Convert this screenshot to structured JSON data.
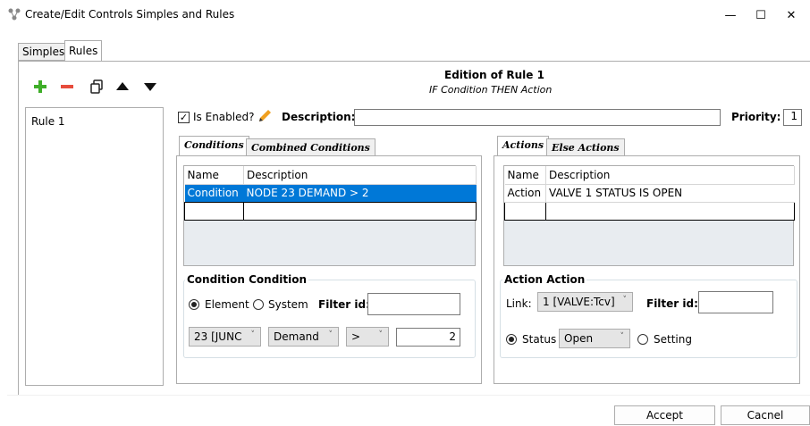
{
  "window": {
    "title": "Create/Edit Controls Simples and Rules",
    "minimize": "—",
    "maximize": "☐",
    "close": "✕"
  },
  "tabs": {
    "simples": "Simples",
    "rules": "Rules"
  },
  "rule_list": [
    "Rule 1"
  ],
  "header": {
    "title": "Edition of Rule 1",
    "subtitle": "IF Condition THEN Action"
  },
  "enabled": {
    "label": "Is Enabled?",
    "checked": "✓"
  },
  "description": {
    "label": "Description:",
    "value": ""
  },
  "priority": {
    "label": "Priority:",
    "value": "1"
  },
  "conditions": {
    "tab_active": "Conditions",
    "tab_inactive": "Combined Conditions",
    "columns": [
      "Name",
      "Description"
    ],
    "rows": [
      {
        "name": "Condition",
        "description": "NODE 23 DEMAND > 2"
      }
    ],
    "group_title": "Condition Condition",
    "element_label": "Element",
    "system_label": "System",
    "filter_label": "Filter id:",
    "filter_value": "",
    "node_combo": "23 [JUNC",
    "attr_combo": "Demand",
    "op_combo": ">",
    "value": "2"
  },
  "actions": {
    "tab_active": "Actions",
    "tab_inactive": "Else Actions",
    "columns": [
      "Name",
      "Description"
    ],
    "rows": [
      {
        "name": "Action",
        "description": "VALVE 1 STATUS IS OPEN"
      }
    ],
    "group_title": "Action Action",
    "link_label": "Link:",
    "link_combo": "1 [VALVE:Tcv]",
    "filter_label": "Filter id:",
    "filter_value": "",
    "status_label": "Status",
    "status_combo": "Open",
    "setting_label": "Setting"
  },
  "buttons": {
    "accept": "Accept",
    "cancel": "Cacnel"
  },
  "colors": {
    "selection": "#0078d7",
    "add": "#3fae29",
    "remove": "#e74c3c",
    "pencil": "#f0a020"
  }
}
